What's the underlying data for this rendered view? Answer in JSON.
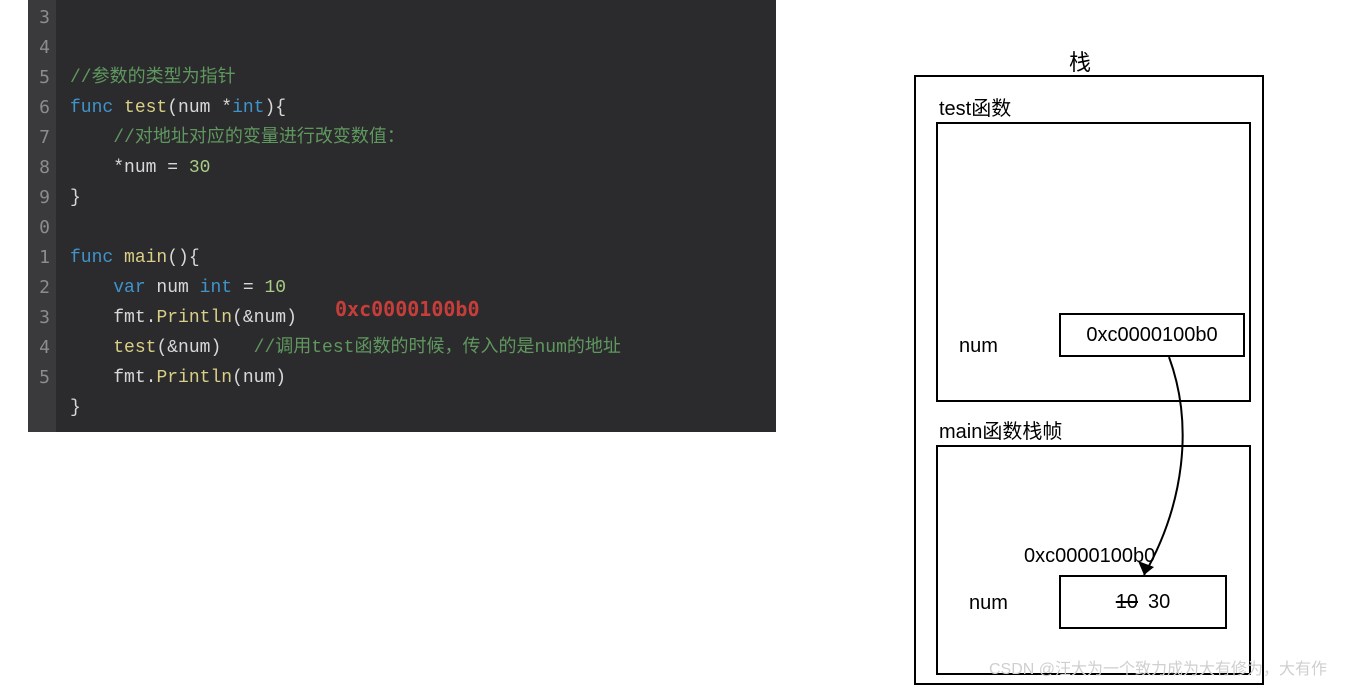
{
  "code": {
    "gutter": [
      "3",
      "4",
      "5",
      "6",
      "7",
      "8",
      "9",
      "0",
      "1",
      "2",
      "3",
      "4",
      "5"
    ],
    "comment1": "//参数的类型为指针",
    "kw_func1": "func",
    "fn_test": "test",
    "sig_test": "(num *",
    "ty_int": "int",
    "sig_test2": "){",
    "comment2": "//对地址对应的变量进行改变数值：",
    "deref": "*num = ",
    "thirty": "30",
    "close1": "}",
    "kw_func2": "func",
    "fn_main": "main",
    "sig_main": "(){",
    "kw_var": "var",
    "var_decl": " num ",
    "ty_int2": "int",
    "eq": " = ",
    "ten": "10",
    "p1a": "fmt.",
    "p1b": "Println",
    "p1c": "(&num)",
    "call_test": "test",
    "call_test_args": "(&num)",
    "comment3": "//调用test函数的时候，传入的是num的地址",
    "p2a": "fmt.",
    "p2b": "Println",
    "p2c": "(num)",
    "close2": "}",
    "addr_annotation": "0xc0000100b0"
  },
  "diagram": {
    "stack_title": "栈",
    "test_label": "test函数",
    "test_num": "num",
    "test_val": "0xc0000100b0",
    "main_label": "main函数栈帧",
    "main_addr": "0xc0000100b0",
    "main_num": "num",
    "main_old": "10",
    "main_new": "30"
  },
  "watermark": "CSDN @汪大为一个致力成为大有修为，大有作"
}
